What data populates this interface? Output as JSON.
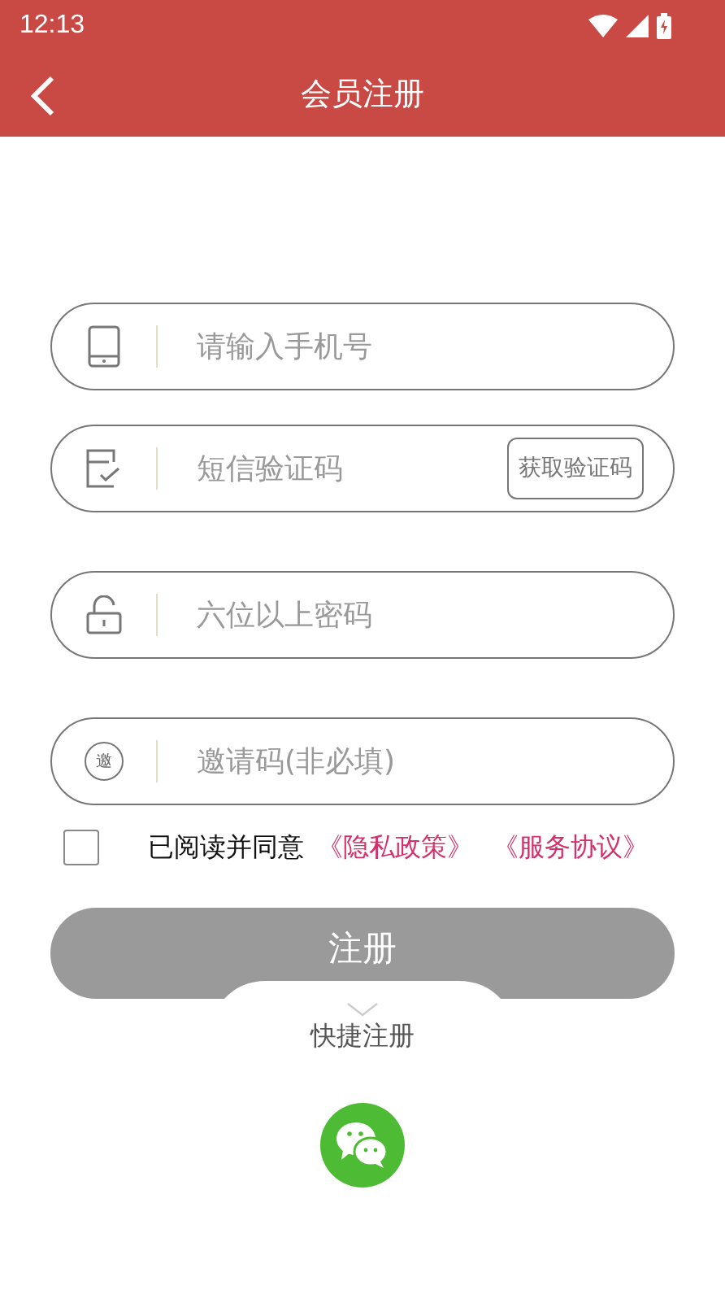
{
  "status_bar": {
    "time": "12:13"
  },
  "header": {
    "title": "会员注册"
  },
  "fields": [
    {
      "kind": "phone",
      "placeholder": "请输入手机号"
    },
    {
      "kind": "sms",
      "placeholder": "短信验证码",
      "button": "获取验证码"
    },
    {
      "kind": "password",
      "placeholder": "六位以上密码"
    },
    {
      "kind": "invite",
      "placeholder": "邀请码(非必填)",
      "badge": "邀"
    }
  ],
  "agreement": {
    "checked": false,
    "text": "已阅读并同意",
    "links": [
      "《隐私政策》",
      "《服务协议》"
    ]
  },
  "submit": {
    "label": "注册",
    "disabled": true
  },
  "quick": {
    "label": "快捷注册"
  }
}
